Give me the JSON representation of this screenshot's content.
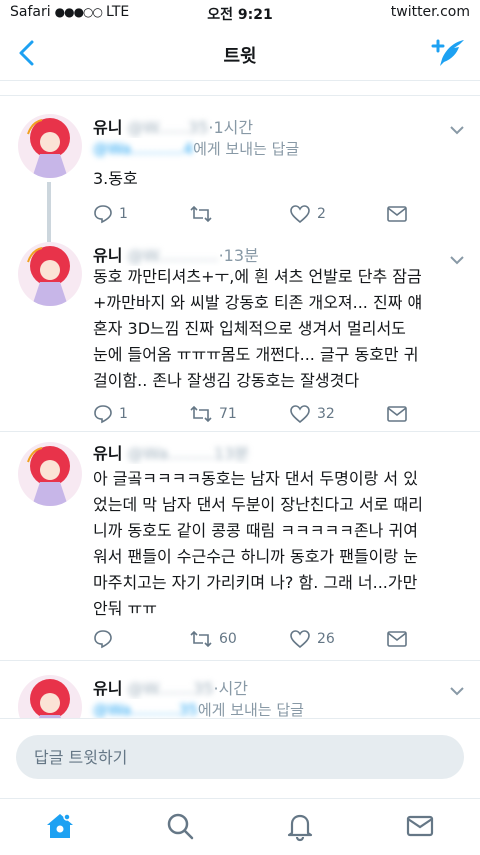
{
  "status_bar": {
    "carrier": "Safari",
    "signal": "●●●○○",
    "network": "LTE",
    "time": "오전 9:21",
    "url": "twitter.com"
  },
  "nav": {
    "title": "트윗",
    "back_icon": "chevron-left-icon",
    "compose_icon": "compose-tweet-icon"
  },
  "accent_color": "#1da1f2",
  "tweets": [
    {
      "name": "유니",
      "handle_blurred": "@W......35",
      "time": "·1시간",
      "reply_suffix": "에게 보내는 답글",
      "reply_handle_blurred": "@Wa...........4",
      "text": "3.동호",
      "replies": "1",
      "retweets": "",
      "likes": "2"
    },
    {
      "name": "유니",
      "handle_blurred": "@W............",
      "time": "·13분",
      "text_lines": [
        "동호 까만티셔츠+ㅜ,에 흰 셔츠 언발로 단추 잠금",
        "+까만바지 와 씨발 강동호 티존 개오져... 진짜 얘",
        "혼자 3D느낌 진짜 입체적으로 생겨서 멀리서도",
        "눈에 들어옴 ㅠㅠㅠ몸도 개쩐다... 글구 동호만 귀",
        "걸이함.. 존나 잘생김 강동호는 잘생겻다"
      ],
      "replies": "1",
      "retweets": "71",
      "likes": "32"
    },
    {
      "name": "유니",
      "handle_blurred": "@Wa.........13분",
      "time": "",
      "text_lines": [
        "아 글곸ㅋㅋㅋㅋ동호는 남자 댄서 두명이랑 서 있",
        "었는데 막 남자 댄서 두분이 장난친다고 서로 때리",
        "니까 동호도 같이 콩콩 때림 ㅋㅋㅋㅋㅋ존나 귀여",
        "워서 팬들이 수근수근 하니까 동호가 팬들이랑 눈",
        "마주치고는 자기 가리키며 나? 함. 그래 너...가만",
        "안둬 ㅠㅠ"
      ],
      "replies": "",
      "retweets": "60",
      "likes": "26"
    },
    {
      "name": "유니",
      "handle_blurred": "@W.......35",
      "time": "·시간",
      "reply_suffix": "에게 보내는 답글",
      "reply_handle_blurred": "@Wa..........35"
    }
  ],
  "reply_bar": {
    "placeholder": "답글 트윗하기"
  },
  "tab_bar": {
    "items": [
      "home-icon",
      "search-icon",
      "notifications-icon",
      "messages-icon"
    ]
  }
}
